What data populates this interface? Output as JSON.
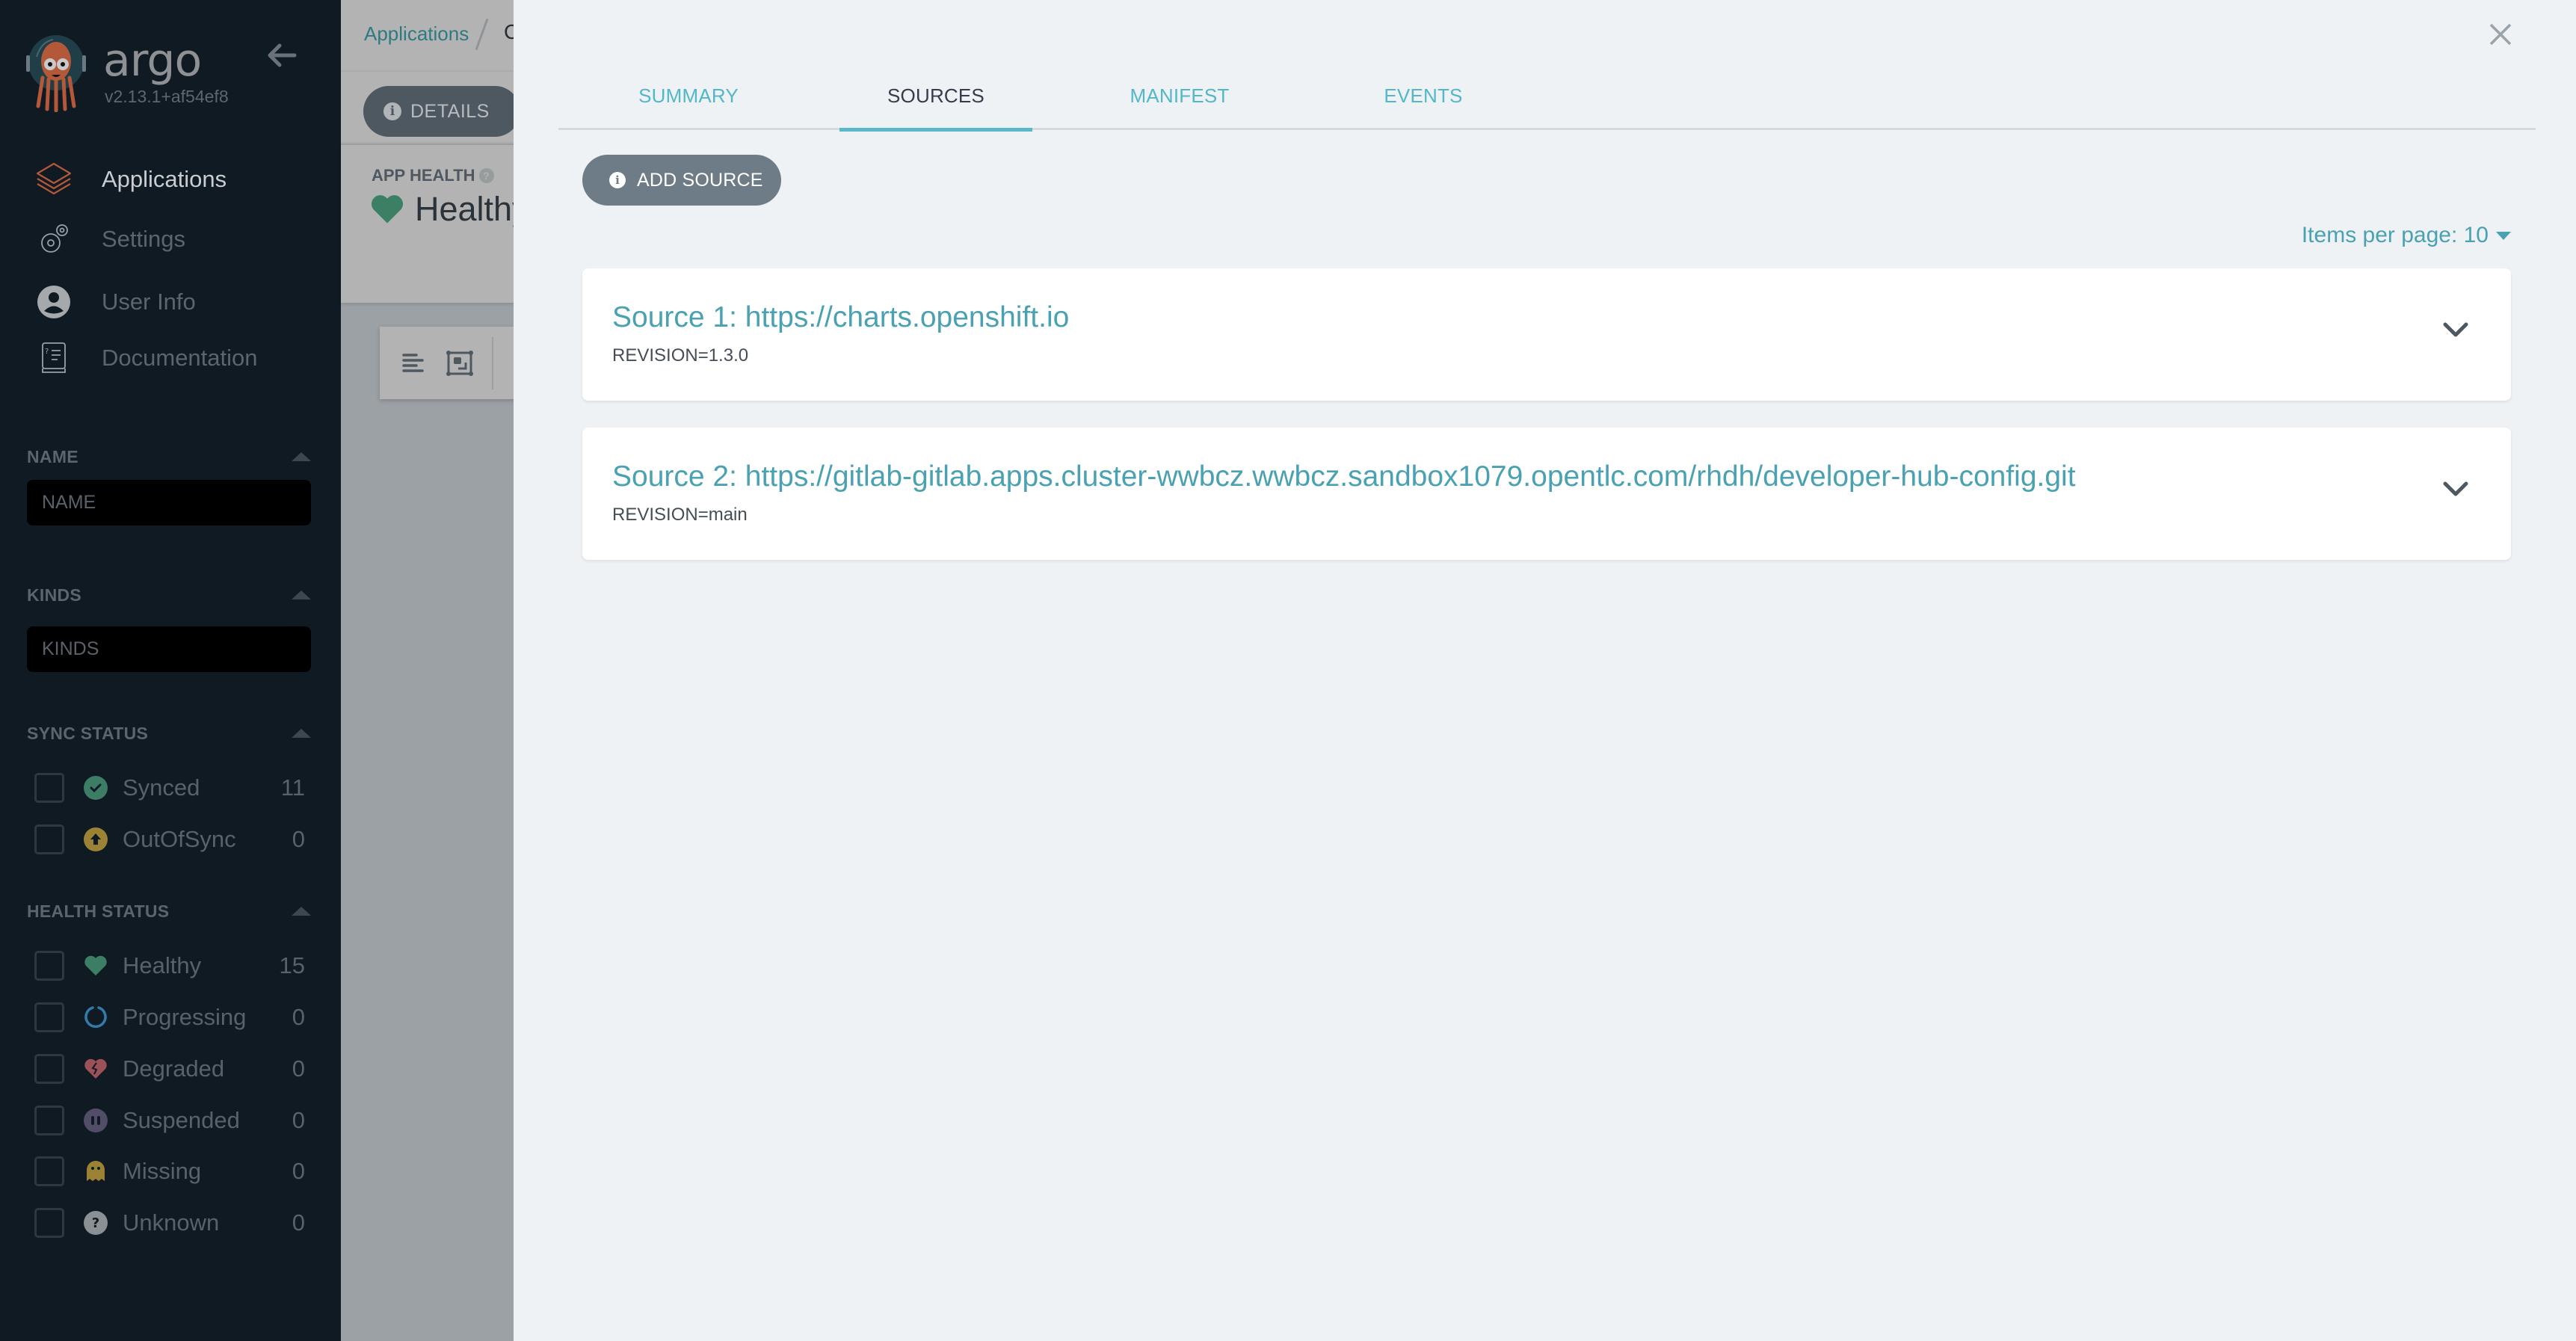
{
  "sidebar": {
    "brand": "argo",
    "version": "v2.13.1+af54ef8",
    "nav": [
      {
        "label": "Applications",
        "icon": "layers-icon",
        "active": true
      },
      {
        "label": "Settings",
        "icon": "gears-icon",
        "active": false
      },
      {
        "label": "User Info",
        "icon": "user-circle-icon",
        "active": false
      },
      {
        "label": "Documentation",
        "icon": "book-icon",
        "active": false
      }
    ],
    "filters": {
      "name": {
        "title": "NAME",
        "placeholder": "NAME",
        "value": ""
      },
      "kinds": {
        "title": "KINDS",
        "placeholder": "KINDS",
        "value": ""
      },
      "sync_status": {
        "title": "SYNC STATUS",
        "items": [
          {
            "label": "Synced",
            "count": "11",
            "icon": "check-circle-icon",
            "color": "#18be94"
          },
          {
            "label": "OutOfSync",
            "count": "0",
            "icon": "arrow-up-circle-icon",
            "color": "#f4c030"
          }
        ]
      },
      "health_status": {
        "title": "HEALTH STATUS",
        "items": [
          {
            "label": "Healthy",
            "count": "15",
            "icon": "heart-icon",
            "color": "#18be94"
          },
          {
            "label": "Progressing",
            "count": "0",
            "icon": "circle-notch-icon",
            "color": "#0dadea"
          },
          {
            "label": "Degraded",
            "count": "0",
            "icon": "heart-broken-icon",
            "color": "#e96d76"
          },
          {
            "label": "Suspended",
            "count": "0",
            "icon": "pause-circle-icon",
            "color": "#766f94"
          },
          {
            "label": "Missing",
            "count": "0",
            "icon": "ghost-icon",
            "color": "#f4c030"
          },
          {
            "label": "Unknown",
            "count": "0",
            "icon": "question-circle-icon",
            "color": "#ccd6dd"
          }
        ]
      }
    }
  },
  "background": {
    "breadcrumb": {
      "link": "Applications",
      "current": "C"
    },
    "details_button": "DETAILS",
    "app_health": {
      "label": "APP HEALTH",
      "value": "Healthy"
    }
  },
  "panel": {
    "tabs": [
      {
        "label": "SUMMARY",
        "active": false
      },
      {
        "label": "SOURCES",
        "active": true
      },
      {
        "label": "MANIFEST",
        "active": false
      },
      {
        "label": "EVENTS",
        "active": false
      }
    ],
    "add_source_label": "ADD SOURCE",
    "items_per_page": "Items per page: 10",
    "sources": [
      {
        "title": "Source 1: https://charts.openshift.io",
        "revision": "REVISION=1.3.0"
      },
      {
        "title": "Source 2: https://gitlab-gitlab.apps.cluster-wwbcz.wwbcz.sandbox1079.opentlc.com/rhdh/developer-hub-config.git",
        "revision": "REVISION=main"
      }
    ]
  },
  "colors": {
    "accent": "#4aa1b2",
    "tab_active_underline": "#5ab8cb",
    "sidebar_bg": "#0f1a22",
    "panel_bg": "#eef2f5"
  }
}
